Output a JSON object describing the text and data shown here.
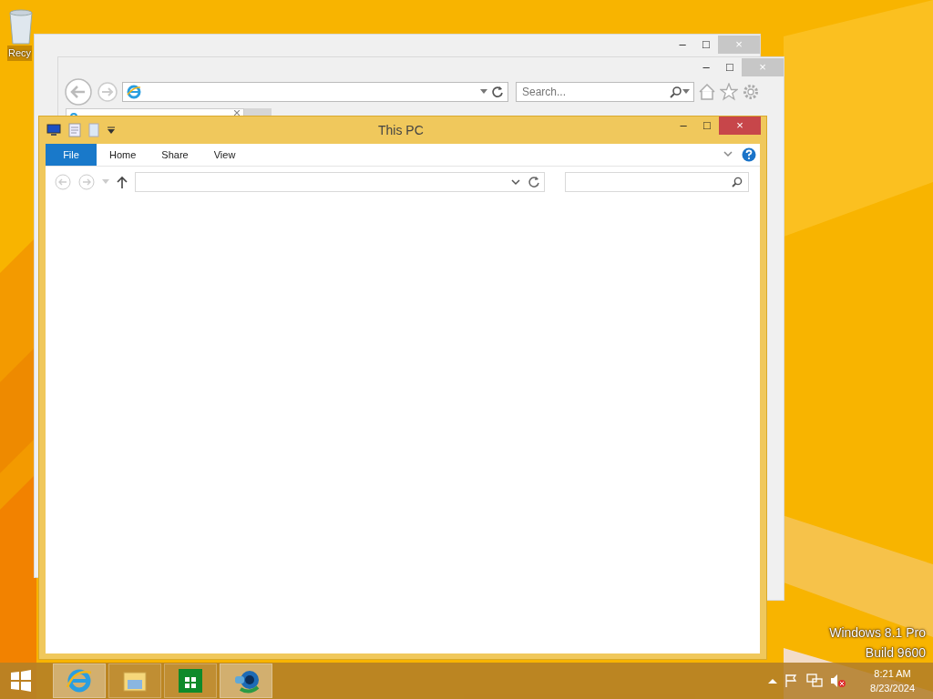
{
  "desktop_icons": [
    {
      "label": "Recy"
    }
  ],
  "browser_back": {
    "title_buttons": [
      "–",
      "□",
      "×"
    ]
  },
  "browser": {
    "search": {
      "placeholder": "Search..."
    }
  },
  "explorer": {
    "title": "This PC",
    "ribbon_tabs": [
      {
        "label": "File",
        "selected": true
      },
      {
        "label": "Home",
        "selected": false
      },
      {
        "label": "Share",
        "selected": false
      },
      {
        "label": "View",
        "selected": false
      }
    ]
  },
  "watermark": [
    "Windows 8.1 Pro",
    "Build 9600"
  ],
  "taskbar": {
    "apps": [
      {
        "kind": "browser",
        "selected": true
      },
      {
        "kind": "folder",
        "selected": false
      },
      {
        "kind": "store",
        "selected": false
      },
      {
        "kind": "panel",
        "selected": true
      }
    ],
    "clock": {
      "time": "8:21 AM",
      "date": "8/23/2024"
    }
  }
}
